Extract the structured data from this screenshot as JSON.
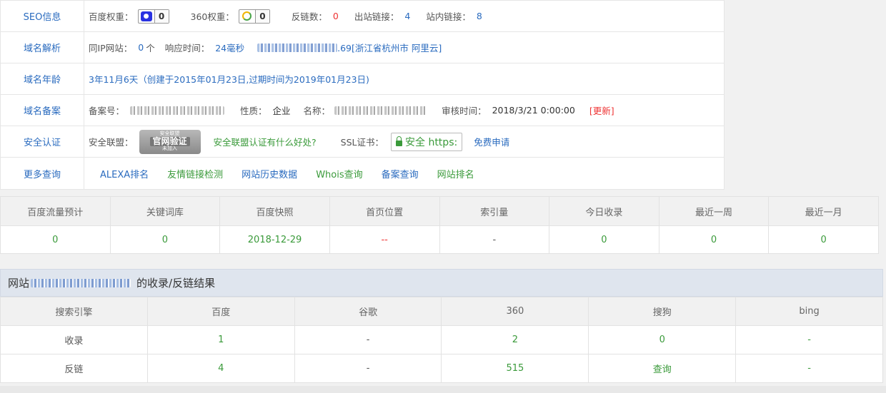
{
  "info": {
    "seo": {
      "label": "SEO信息",
      "baidu_weight_label": "百度权重：",
      "baidu_weight": "0",
      "w360_label": "360权重：",
      "w360": "0",
      "backlinks_label": "反链数：",
      "backlinks": "0",
      "outbound_label": "出站链接：",
      "outbound": "4",
      "internal_label": "站内链接：",
      "internal": "8"
    },
    "dns": {
      "label": "域名解析",
      "same_ip_label": "同IP网站：",
      "same_ip_count": "0",
      "same_ip_unit": "个",
      "response_label": "响应时间：",
      "response_time": "24毫秒",
      "ip_suffix": ".69[浙江省杭州市 阿里云]"
    },
    "age": {
      "label": "域名年龄",
      "value": "3年11月6天（创建于2015年01月23日,过期时间为2019年01月23日)"
    },
    "icp": {
      "label": "域名备案",
      "icp_label": "备案号：",
      "nature_label": "性质：",
      "nature": "企业",
      "name_label": "名称：",
      "review_label": "审核时间：",
      "review_time": "2018/3/21 0:00:00",
      "update_link": "[更新]"
    },
    "security": {
      "label": "安全认证",
      "alliance_label": "安全联盟：",
      "seal_top": "安全联盟",
      "seal_mid": "官网验证",
      "seal_bottom": "未加入",
      "alliance_link": "安全联盟认证有什么好处?",
      "ssl_label": "SSL证书：",
      "ssl_badge": "安全 https:",
      "free_apply": "免费申请"
    },
    "more": {
      "label": "更多查询",
      "links": [
        "ALEXA排名",
        "友情链接检测",
        "网站历史数据",
        "Whois查询",
        "备案查询",
        "网站排名"
      ]
    }
  },
  "stats": {
    "headers": [
      "百度流量预计",
      "关键词库",
      "百度快照",
      "首页位置",
      "索引量",
      "今日收录",
      "最近一周",
      "最近一月"
    ],
    "values": [
      "0",
      "0",
      "2018-12-29",
      "--",
      "-",
      "0",
      "0",
      "0"
    ]
  },
  "results": {
    "title_prefix": "网站",
    "title_suffix": "的收录/反链结果",
    "headers": [
      "搜索引擎",
      "百度",
      "谷歌",
      "360",
      "搜狗",
      "bing"
    ],
    "rows": [
      [
        "收录",
        "1",
        "-",
        "2",
        "0",
        "-"
      ],
      [
        "反链",
        "4",
        "-",
        "515",
        "查询",
        "-"
      ]
    ]
  },
  "colors": {
    "link_blue": "#2a6bbf",
    "value_green": "#3a9a3a",
    "alert_red": "#e33333"
  }
}
